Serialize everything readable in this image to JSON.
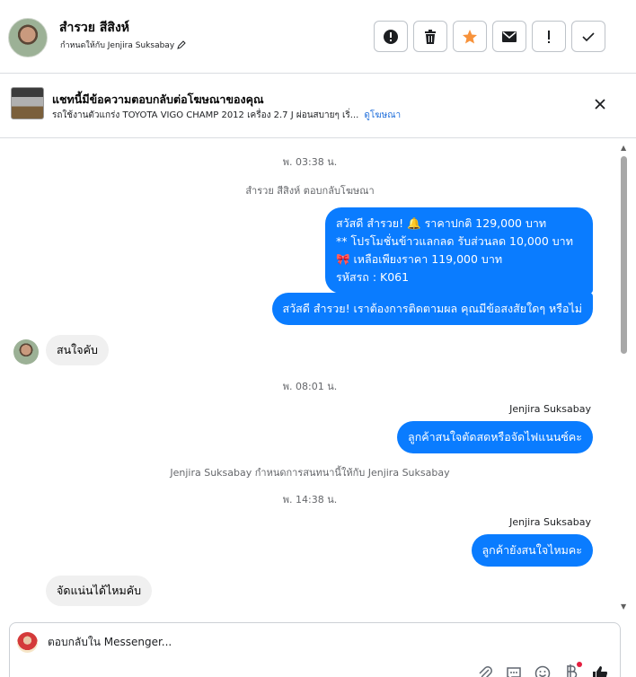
{
  "header": {
    "name": "สำรวย สีสิงห์",
    "assigned": "กำหนดให้กับ Jenjira Suksabay",
    "actions": [
      "report-icon",
      "trash-icon",
      "star-icon",
      "mail-icon",
      "exclamation-icon",
      "check-icon"
    ],
    "star_color": "#f7923b"
  },
  "ad": {
    "title": "แชทนี้มีข้อความตอบกลับต่อโฆษณาของคุณ",
    "description": "รถใช้งานตัวแกร่ง TOYOTA VIGO CHAMP 2012 เครื่อง 2.7 J ผ่อนสบายๆ เริ่...",
    "link": "ดูโฆษณา"
  },
  "thread": {
    "ts1": "พ. 03:38 น.",
    "notice1": "สำรวย สีสิงห์ ตอบกลับโฆษณา",
    "out1": {
      "line1": "สวัสดี สำรวย! 🔔 ราคาปกติ 129,000 บาท",
      "line2": "** โปรโมชั่นข้าวแลกลด รับส่วนลด 10,000 บาท",
      "line3": "🎀  เหลือเพียงราคา 119,000 บาท",
      "line4": " รหัสรถ : K061"
    },
    "out2": "สวัสดี สำรวย! เราต้องการติดตามผล คุณมีข้อสงสัยใดๆ หรือไม่",
    "in1": "สนใจคับ",
    "ts2": "พ. 08:01 น.",
    "sender1": "Jenjira Suksabay",
    "out3": "ลูกค้าสนใจตัดสดหรือจัดไฟแนนซ์คะ",
    "notice2": "Jenjira Suksabay กำหนดการสนทนานี้ให้กับ Jenjira Suksabay",
    "ts3": "พ. 14:38 น.",
    "sender2": "Jenjira Suksabay",
    "out4": "ลูกค้ายังสนใจไหมคะ",
    "in2": "จัดแน่นได้ไหมคับ"
  },
  "composer": {
    "placeholder": "ตอบกลับใน Messenger...",
    "tools": [
      "attach-icon",
      "chat-icon",
      "emoji-icon",
      "baht-icon",
      "like-icon"
    ],
    "accent": "#0a7cff"
  }
}
